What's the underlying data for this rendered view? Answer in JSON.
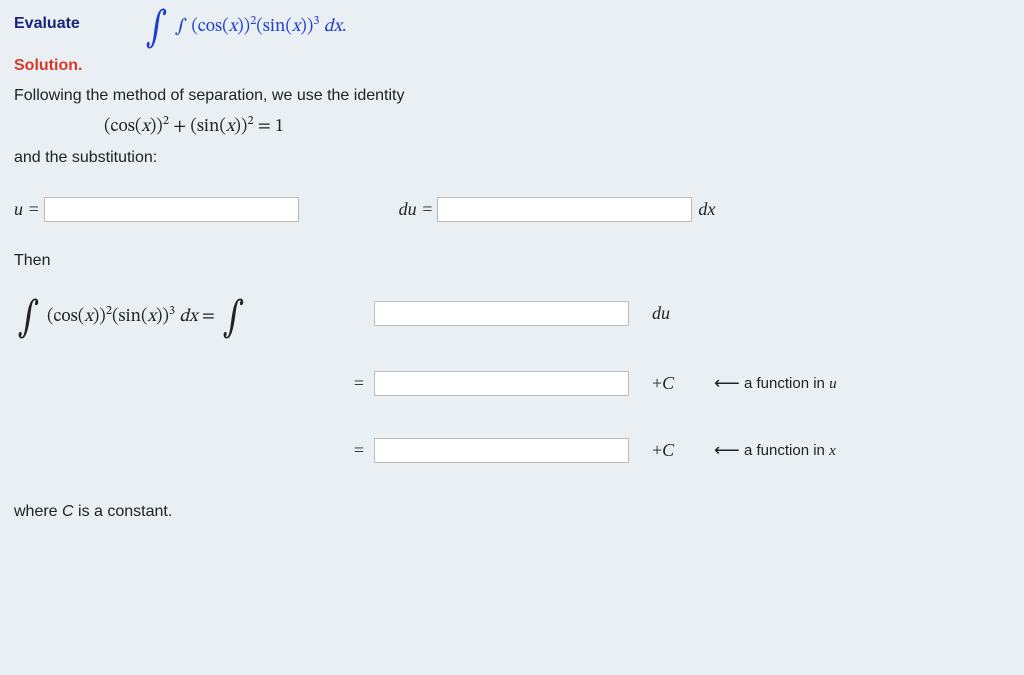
{
  "prompt": {
    "label": "Evaluate",
    "integral_html": "∫ (cos(<i>x</i>))<span class='sup'>2</span>(sin(<i>x</i>))<span class='sup'>3</span> <i>dx</i>."
  },
  "solution": {
    "heading": "Solution.",
    "line1": "Following the method of separation, we use the identity",
    "identity_html": "(cos(<i>x</i>))<span class='sup'>2</span>  +  (sin(<i>x</i>))<span class='sup'>2</span>  =  1",
    "line2": "and the substitution:"
  },
  "subst": {
    "u_label": "u =",
    "du_label": "du =",
    "dx_label": "dx",
    "u_value": "",
    "du_value": ""
  },
  "then_label": "Then",
  "steps": {
    "lhs_html": "<span class='intsym'>∫</span> (cos(<i>x</i>))<span class='sup'>2</span>(sin(<i>x</i>))<span class='sup'>3</span> <i>dx</i>  =  <span class='intsym'>∫</span>",
    "row1_suffix": "du",
    "row2_suffix": "+C",
    "row3_suffix": "+C",
    "arrow": "⟵",
    "note_u": "a function in u",
    "note_x": "a function in x",
    "in1": "",
    "in2": "",
    "in3": ""
  },
  "footer_html": "where <i>C</i> is a constant."
}
